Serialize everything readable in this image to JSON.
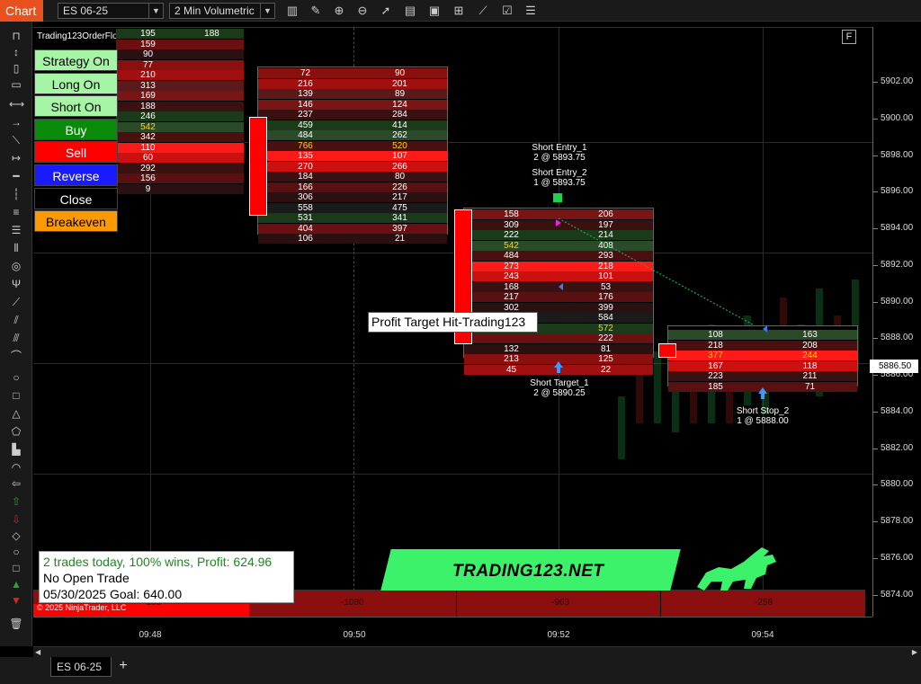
{
  "toolbar": {
    "chart_tab": "Chart",
    "instrument": "ES 06-25",
    "bar_type": "2 Min Volumetric",
    "icons": [
      "data-series-icon",
      "pencil-icon",
      "zoom-in-icon",
      "zoom-out-icon",
      "cursor-icon",
      "properties-icon",
      "screenshot-icon",
      "indicators-icon",
      "strategies-icon",
      "menu-icon"
    ]
  },
  "chart": {
    "indicator_title": "Trading123OrderFlowBotV2",
    "f_button": "F",
    "y_ticks": [
      "5902.00",
      "5900.00",
      "5898.00",
      "5896.00",
      "5894.00",
      "5892.00",
      "5890.00",
      "5888.00",
      "5886.00",
      "5884.00",
      "5882.00",
      "5880.00",
      "5878.00",
      "5876.00",
      "5874.00"
    ],
    "y_range": [
      5872.8,
      5905.0
    ],
    "current_price": "5886.50",
    "x_ticks": [
      "09:48",
      "09:50",
      "09:52",
      "09:54"
    ],
    "copyright": "© 2025 NinjaTrader, LLC"
  },
  "control_panel": [
    {
      "label": "Strategy On",
      "bg": "#a6f5a6",
      "fg": "#000"
    },
    {
      "label": "Long On",
      "bg": "#a6f5a6",
      "fg": "#000"
    },
    {
      "label": "Short On",
      "bg": "#a6f5a6",
      "fg": "#000"
    },
    {
      "label": "Buy",
      "bg": "#0a8a0a",
      "fg": "#fff"
    },
    {
      "label": "Sell",
      "bg": "#ff0000",
      "fg": "#fff"
    },
    {
      "label": "Reverse",
      "bg": "#1a1aff",
      "fg": "#fff"
    },
    {
      "label": "Close",
      "bg": "#000",
      "fg": "#fff"
    },
    {
      "label": "Breakeven",
      "bg": "#ff9900",
      "fg": "#000"
    }
  ],
  "footprints": [
    {
      "rows": [
        [
          "195",
          "188"
        ],
        [
          "159",
          ""
        ],
        [
          "90",
          ""
        ],
        [
          "77",
          ""
        ],
        [
          "210",
          ""
        ],
        [
          "313",
          ""
        ],
        [
          "169",
          ""
        ],
        [
          "188",
          ""
        ],
        [
          "246",
          ""
        ],
        [
          "542",
          ""
        ],
        [
          "342",
          ""
        ],
        [
          "110",
          ""
        ],
        [
          "60",
          ""
        ],
        [
          "292",
          ""
        ],
        [
          "156",
          ""
        ],
        [
          "9",
          ""
        ]
      ]
    },
    {
      "rows": [
        [
          "72",
          "90"
        ],
        [
          "216",
          "201"
        ],
        [
          "139",
          "89"
        ],
        [
          "146",
          "124"
        ],
        [
          "237",
          "284"
        ],
        [
          "459",
          "414"
        ],
        [
          "484",
          "262"
        ],
        [
          "766",
          "520"
        ],
        [
          "135",
          "107"
        ],
        [
          "270",
          "266"
        ],
        [
          "184",
          "80"
        ],
        [
          "166",
          "226"
        ],
        [
          "306",
          "217"
        ],
        [
          "558",
          "475"
        ],
        [
          "531",
          "341"
        ],
        [
          "404",
          "397"
        ],
        [
          "106",
          "21"
        ]
      ]
    },
    {
      "rows": [
        [
          "158",
          "206"
        ],
        [
          "309",
          "197"
        ],
        [
          "222",
          "214"
        ],
        [
          "542",
          "408"
        ],
        [
          "484",
          "293"
        ],
        [
          "273",
          "218"
        ],
        [
          "243",
          "101"
        ],
        [
          "168",
          "53"
        ],
        [
          "217",
          "176"
        ],
        [
          "302",
          "399"
        ],
        [
          "539",
          "584"
        ],
        [
          "",
          "572"
        ],
        [
          "",
          "222"
        ],
        [
          "132",
          "81"
        ],
        [
          "213",
          "125"
        ],
        [
          "45",
          "22"
        ]
      ]
    },
    {
      "rows": [
        [
          "108",
          "163"
        ],
        [
          "218",
          "208"
        ],
        [
          "377",
          "244"
        ],
        [
          "167",
          "118"
        ],
        [
          "223",
          "211"
        ],
        [
          "185",
          "71"
        ]
      ]
    }
  ],
  "labels": {
    "short_entry_1": "Short Entry_1",
    "short_entry_1_detail": "2 @ 5893.75",
    "short_entry_2": "Short Entry_2",
    "short_entry_2_detail": "1 @ 5893.75",
    "short_target_1": "Short Target_1",
    "short_target_1_detail": "2 @ 5890.25",
    "short_stop_2": "Short Stop_2",
    "short_stop_2_detail": "1 @ 5888.00",
    "profit_target": "Profit Target Hit-Trading123"
  },
  "stats": {
    "line1": "2 trades today, 100% wins, Profit: 624.96",
    "line2": "No Open Trade",
    "line3": "05/30/2025 Goal: 640.00"
  },
  "bottom_strip": [
    "-188",
    "-1080",
    "-963",
    "-258"
  ],
  "brand": "TRADING123.NET",
  "bottom_tab": "ES 06-25",
  "bottom_tab_add": "+"
}
